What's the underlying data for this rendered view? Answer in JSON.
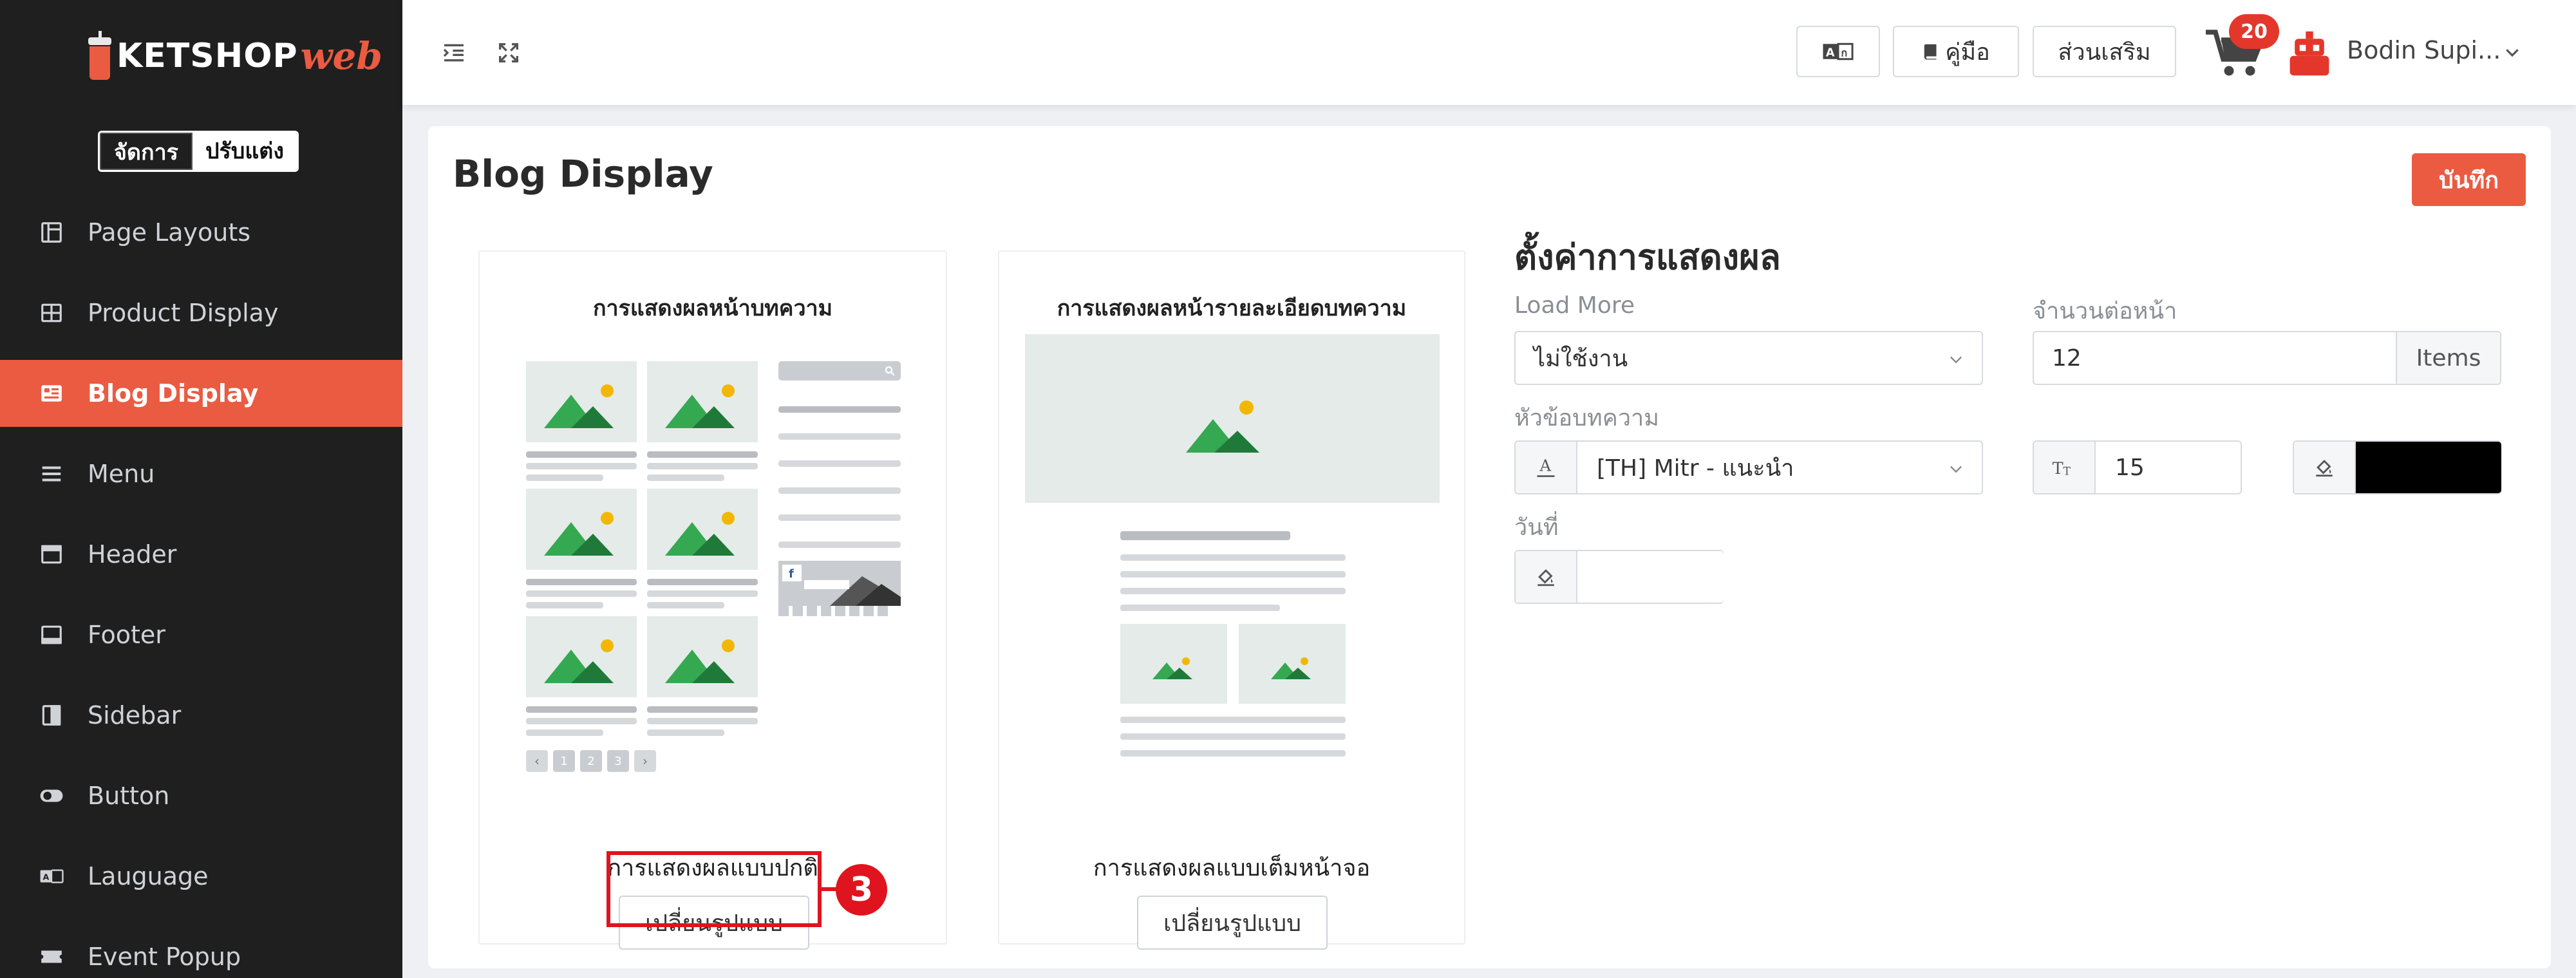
{
  "brand": {
    "name": "KETSHOP",
    "suffix": "web"
  },
  "mode_toggle": {
    "manage": "จัดการ",
    "customize": "ปรับแต่ง"
  },
  "sidebar": {
    "items": [
      {
        "label": "Page Layouts",
        "icon": "layout-icon"
      },
      {
        "label": "Product Display",
        "icon": "grid-icon"
      },
      {
        "label": "Blog Display",
        "icon": "blog-icon",
        "active": true
      },
      {
        "label": "Menu",
        "icon": "menu-icon"
      },
      {
        "label": "Header",
        "icon": "header-icon"
      },
      {
        "label": "Footer",
        "icon": "footer-icon"
      },
      {
        "label": "Sidebar",
        "icon": "sidebar-icon"
      },
      {
        "label": "Button",
        "icon": "toggle-icon"
      },
      {
        "label": "Lauguage",
        "icon": "language-icon"
      },
      {
        "label": "Event Popup",
        "icon": "ticket-icon"
      }
    ]
  },
  "topbar": {
    "manual_label": "คู่มือ",
    "addons_label": "ส่วนเสริม",
    "cart_count": "20",
    "user_name": "Bodin Supi..."
  },
  "page": {
    "title": "Blog Display",
    "save_label": "บันทึก"
  },
  "layouts": [
    {
      "title": "การแสดงผลหน้าบทความ",
      "caption": "การแสดงผลแบบปกติ",
      "button": "เปลี่ยนรูปแบบ"
    },
    {
      "title": "การแสดงผลหน้ารายละเอียดบทความ",
      "caption": "การแสดงผลแบบเต็มหน้าจอ",
      "button": "เปลี่ยนรูปแบบ"
    }
  ],
  "annotation": {
    "step": "3"
  },
  "mock": {
    "pages": [
      "1",
      "2",
      "3"
    ]
  },
  "settings": {
    "title": "ตั้งค่าการแสดงผล",
    "load_more": {
      "label": "Load More",
      "value": "ไม่ใช้งาน"
    },
    "per_page": {
      "label": "จำนวนต่อหน้า",
      "value": "12",
      "unit": "Items"
    },
    "heading": {
      "label": "หัวข้อบทความ",
      "font": "[TH] Mitr - แนะนำ",
      "size": "15",
      "color": "#000000"
    },
    "date": {
      "label": "วันที่",
      "color": "#ffffff"
    }
  },
  "colors": {
    "accent": "#ea5b42",
    "sidebar_bg": "#1f1f1f",
    "annotation": "#e0141e"
  }
}
